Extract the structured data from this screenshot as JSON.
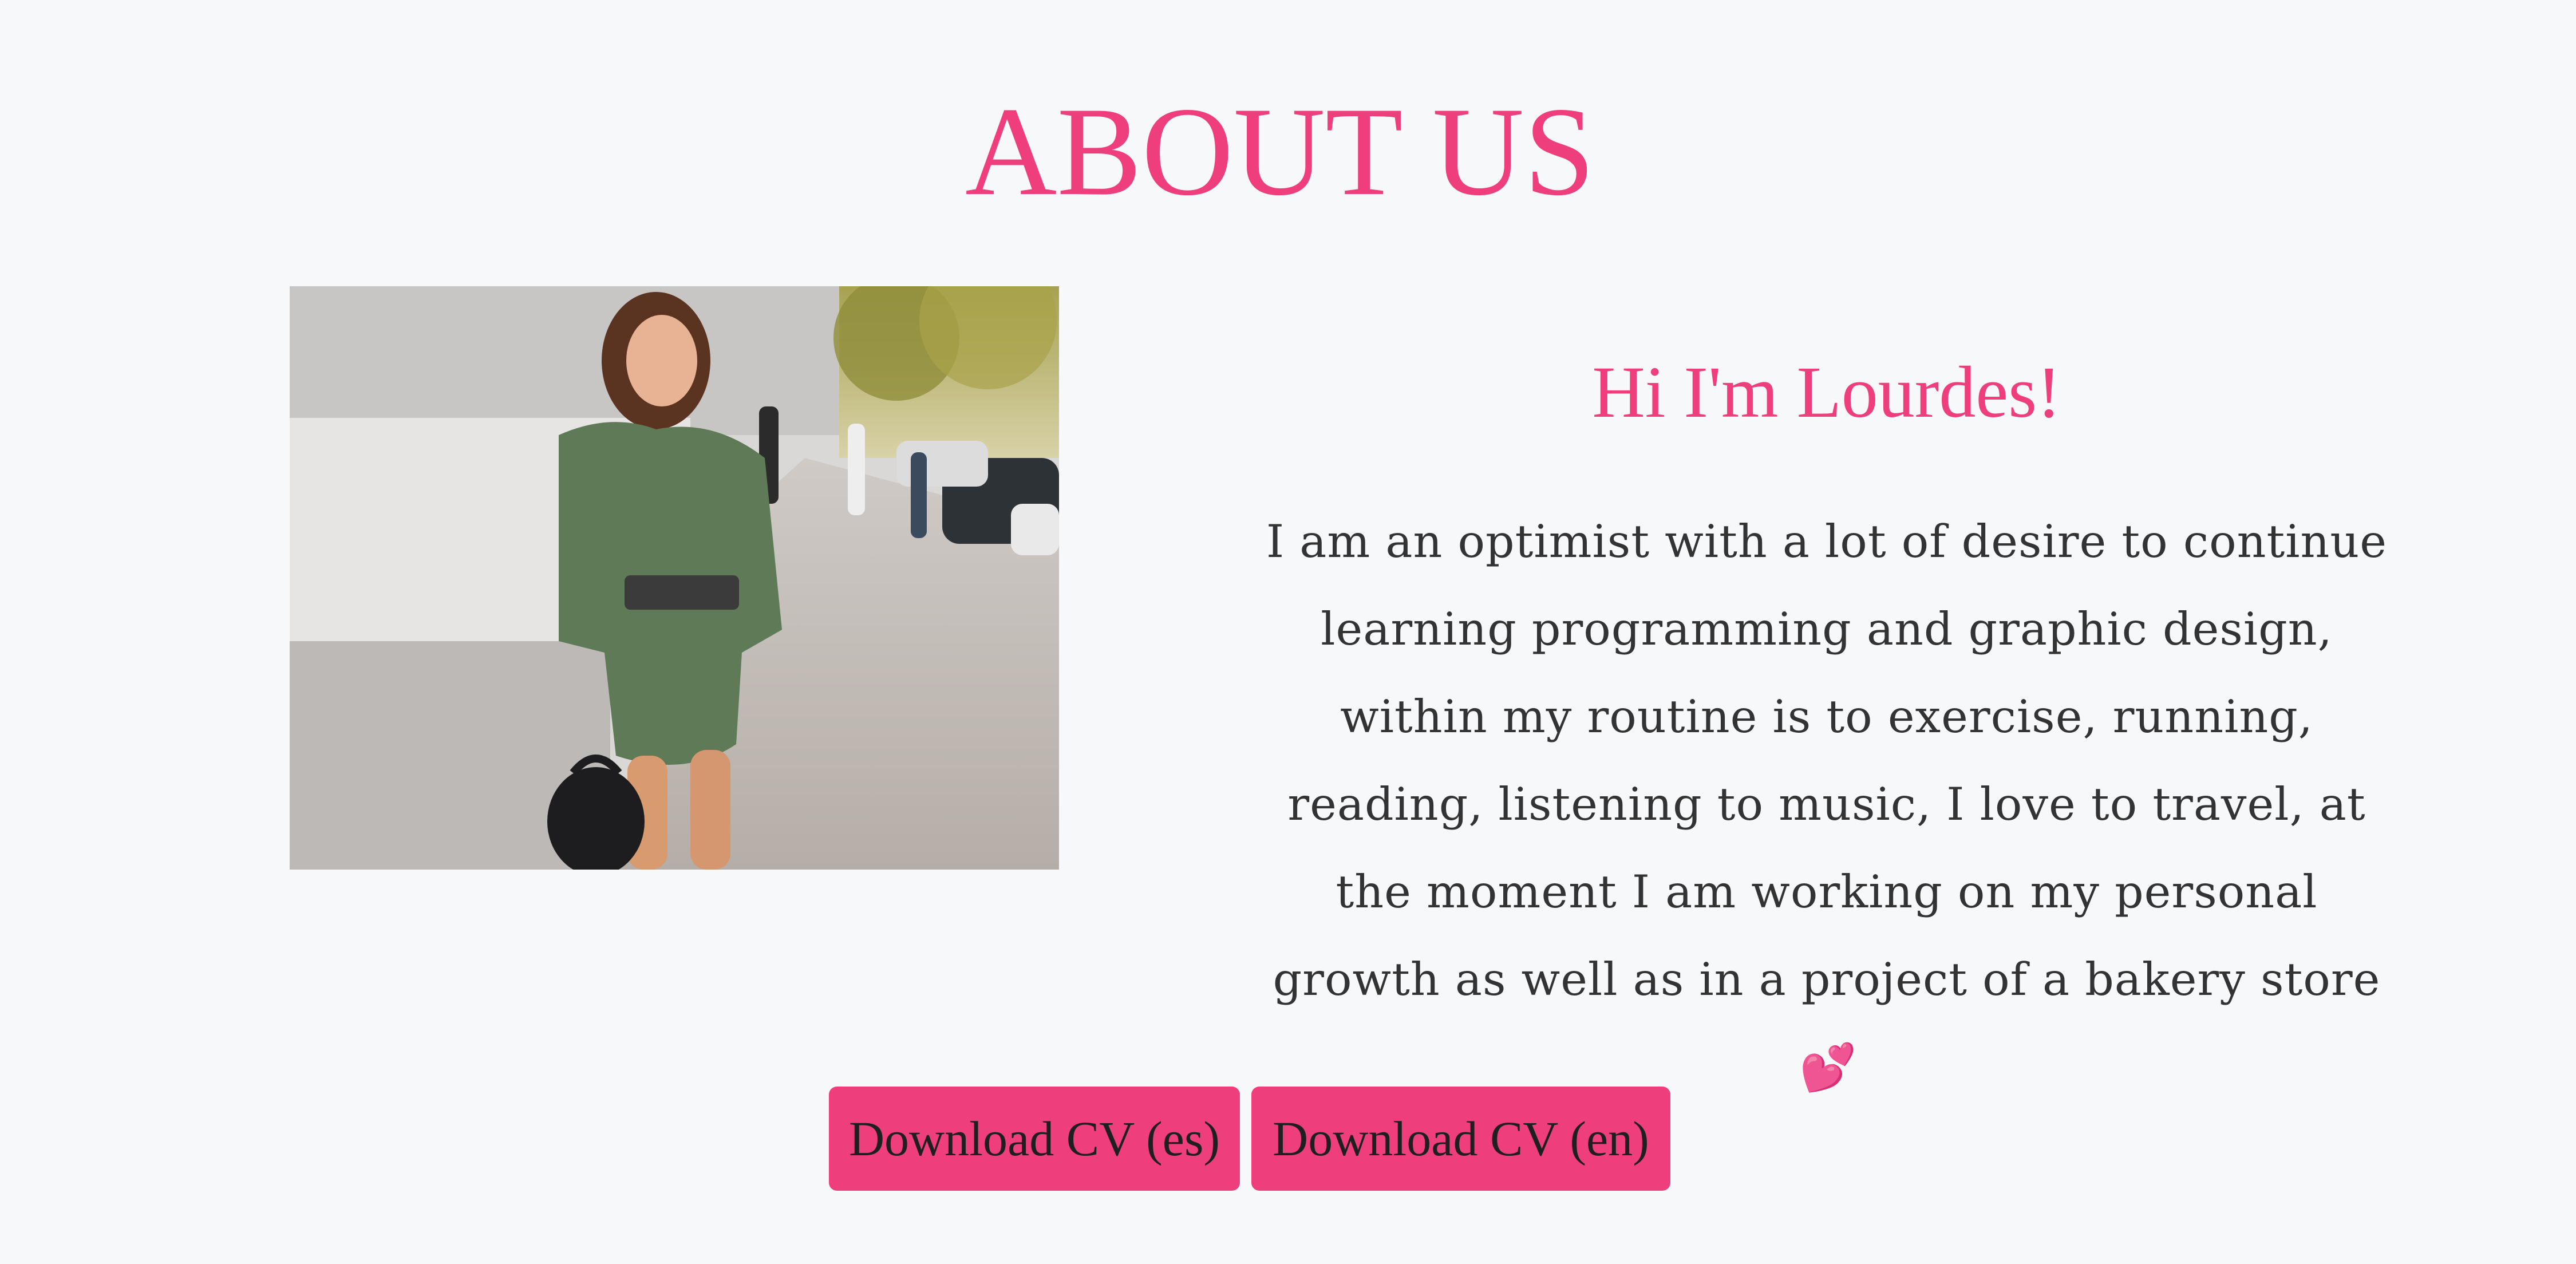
{
  "about": {
    "title": "ABOUT US",
    "photo_alt": "Woman in green shirt dress walking on a city street",
    "greeting": "Hi I'm Lourdes!",
    "bio": "I am an optimist with a lot of desire to continue learning programming and graphic design, within my routine is to exercise, running, reading, listening to music, I love to travel, at the moment I am working on my personal growth as well as in a project of a bakery store",
    "bio_emoji": "💕"
  },
  "buttons": {
    "download_es": "Download CV (es)",
    "download_en": "Download CV (en)"
  },
  "colors": {
    "accent": "#ee3f7c",
    "background": "#f7f8fa",
    "text": "#333333"
  }
}
